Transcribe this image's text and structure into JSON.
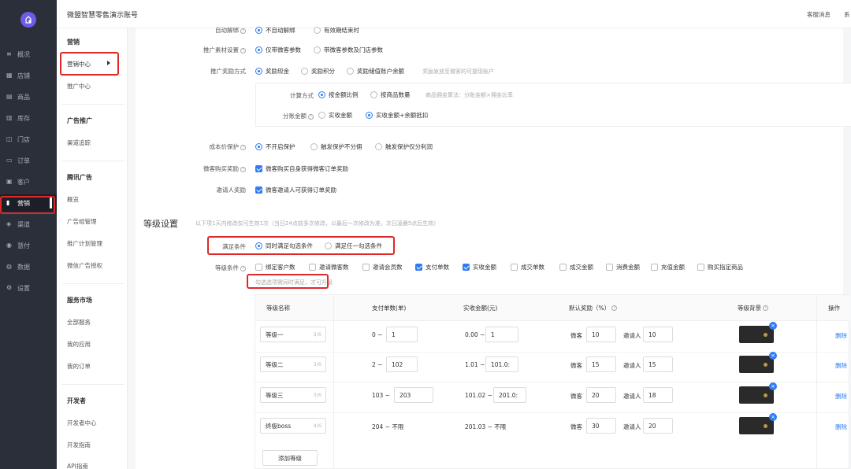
{
  "app": {
    "title": "微盟智慧零售演示账号",
    "header_links": [
      "客服消息",
      "系"
    ]
  },
  "leftnav": [
    {
      "label": "概况",
      "icon": "dashboard-icon"
    },
    {
      "label": "店铺",
      "icon": "store-icon"
    },
    {
      "label": "商品",
      "icon": "goods-icon"
    },
    {
      "label": "库存",
      "icon": "inventory-icon"
    },
    {
      "label": "门店",
      "icon": "shop-icon"
    },
    {
      "label": "订单",
      "icon": "order-icon"
    },
    {
      "label": "客户",
      "icon": "customer-icon"
    },
    {
      "label": "营销",
      "icon": "marketing-icon",
      "active": true
    },
    {
      "label": "渠道",
      "icon": "channel-icon"
    },
    {
      "label": "慧付",
      "icon": "pay-icon"
    },
    {
      "label": "数据",
      "icon": "data-icon"
    },
    {
      "label": "设置",
      "icon": "settings-icon"
    }
  ],
  "subnav": {
    "groups": [
      {
        "title": "营销",
        "items": [
          "营销中心",
          "推广中心"
        ]
      },
      {
        "title": "广告推广",
        "items": [
          "渠道追踪"
        ]
      },
      {
        "title": "腾讯广告",
        "items": [
          "概览",
          "广告组管理",
          "推广计划管理",
          "微信广告授权"
        ]
      },
      {
        "title": "服务市场",
        "items": [
          "全部服务",
          "我的应用",
          "我的订单"
        ]
      },
      {
        "title": "开发者",
        "items": [
          "开发者中心",
          "开发指南",
          "API指南"
        ]
      }
    ]
  },
  "form": {
    "auto_unbind": {
      "label": "自动解绑",
      "options": [
        "不自动解绑",
        "有效期结束时"
      ]
    },
    "material": {
      "label": "推广素材设置",
      "options": [
        "仅带微客参数",
        "带微客参数及门店参数"
      ]
    },
    "reward_method": {
      "label": "推广奖励方式",
      "options": [
        "奖励现金",
        "奖励积分",
        "奖励储值账户余额"
      ],
      "hint": "奖励发放至微客的可提现账户"
    },
    "calc_method": {
      "label": "计算方式",
      "options": [
        "按金额比例",
        "按商品数量"
      ],
      "hint": "商品佣金算法：分账金额×佣金比率"
    },
    "split_amount": {
      "label": "分账金额",
      "options": [
        "实收金额",
        "实收金额+余额抵扣"
      ]
    },
    "cost_protect": {
      "label": "成本价保护",
      "options": [
        "不开启保护",
        "触发保护不分佣",
        "触发保护仅分利润"
      ]
    },
    "self_buy": {
      "label": "微客购买奖励",
      "checkbox": "微客购买自身获得微客订单奖励"
    },
    "inviter": {
      "label": "邀请人奖励",
      "checkbox": "微客邀请人可获得订单奖励"
    }
  },
  "level": {
    "title": "等级设置",
    "tip": "以下项1天内修改仅可生效1次（当日24点前多次修改，以最后一次修改为准，次日凌晨5点后生效）",
    "condition": {
      "label": "满足条件",
      "options": [
        "同时满足勾选条件",
        "满足任一勾选条件"
      ]
    },
    "conditions": {
      "label": "等级条件",
      "items": [
        {
          "label": "绑定客户数",
          "checked": false
        },
        {
          "label": "邀请微客数",
          "checked": false
        },
        {
          "label": "邀请会员数",
          "checked": false
        },
        {
          "label": "支付单数",
          "checked": true
        },
        {
          "label": "实收金额",
          "checked": true
        },
        {
          "label": "成交单数",
          "checked": false
        },
        {
          "label": "成交金额",
          "checked": false
        },
        {
          "label": "消费金额",
          "checked": false
        },
        {
          "label": "充值金额",
          "checked": false
        },
        {
          "label": "购买指定商品",
          "checked": false
        }
      ]
    },
    "cond_hint": "勾选选项需同时满足，才可升级",
    "table": {
      "headers": [
        "等级名称",
        "支付单数(单)",
        "实收金额(元)",
        "默认奖励（%）",
        "等级背景",
        "操作"
      ],
      "rows": [
        {
          "name": "等级一",
          "count": "3/6",
          "pay_from": "0 ~",
          "pay_to": "1",
          "amt_from": "0.00 ~",
          "amt_to": "1",
          "wk": "10",
          "yq": "10"
        },
        {
          "name": "等级二",
          "count": "3/6",
          "pay_from": "2 ~",
          "pay_to": "102",
          "amt_from": "1.01 ~",
          "amt_to": "101.0:",
          "wk": "15",
          "yq": "15"
        },
        {
          "name": "等级三",
          "count": "3/6",
          "pay_from": "103 ~",
          "pay_to": "203",
          "amt_from": "101.02 ~",
          "amt_to": "201.0:",
          "wk": "20",
          "yq": "18"
        },
        {
          "name": "终极boss",
          "count": "4/6",
          "pay_from": "204 ~ 不限",
          "pay_to": "",
          "amt_from": "201.03 ~ 不限",
          "amt_to": "",
          "wk": "30",
          "yq": "20"
        }
      ],
      "wk_label": "微客",
      "yq_label": "邀请人",
      "delete_label": "删除"
    },
    "add_button": "添加等级"
  },
  "colors": {
    "primary": "#2d7bf5",
    "nav_bg": "#2b2f3a",
    "highlight": "#e02828"
  }
}
